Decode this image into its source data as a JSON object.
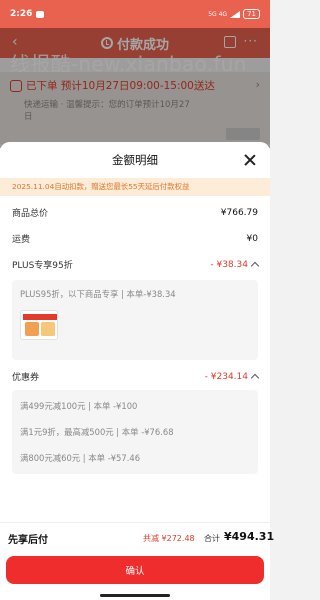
{
  "status_bar": {
    "time": "2:26",
    "network": "5G 4G",
    "battery": "71"
  },
  "bg_page": {
    "title": "付款成功",
    "watermark": "线报酷-new.xianbao.fun",
    "status_line": "已下单 预计10月27日09:00-15:00送达",
    "shipping_line1": "快递运输 · 温馨提示：您的订单预计10月27",
    "shipping_line2": "日"
  },
  "sheet": {
    "title": "金额明细",
    "notice": "2025.11.04自动扣款，赠送您最长55天延后付款权益",
    "rows": {
      "goods_total": {
        "label": "商品总价",
        "value": "¥766.79"
      },
      "shipping": {
        "label": "运费",
        "value": "¥0"
      },
      "plus": {
        "label": "PLUS专享95折",
        "value": "- ¥38.34"
      },
      "coupon": {
        "label": "优惠券",
        "value": "- ¥234.14"
      }
    },
    "plus_detail": "PLUS95折，以下商品专享 | 本单-¥38.34",
    "coupons": [
      "满499元减100元 | 本单 -¥100",
      "满1元9折，最高减500元 | 本单 -¥76.68",
      "满800元减60元 | 本单 -¥57.46"
    ]
  },
  "footer": {
    "label": "先享后付",
    "saved": "共减 ¥272.48",
    "total_label": "合计",
    "total": "¥494.31",
    "confirm": "确认"
  }
}
